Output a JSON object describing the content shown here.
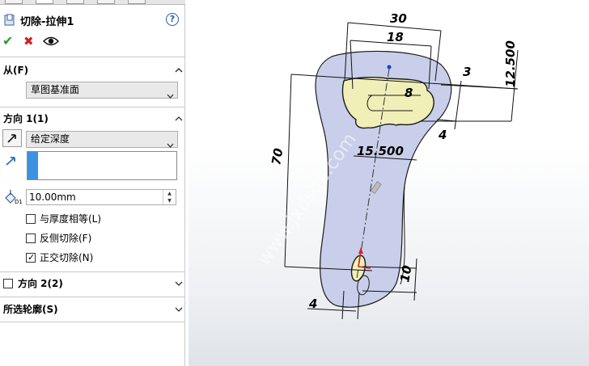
{
  "feature": {
    "title": "切除-拉伸1",
    "help": "?"
  },
  "actions": {
    "ok": "✔",
    "cancel": "✖"
  },
  "from": {
    "header": "从(F)",
    "value": "草图基准面"
  },
  "direction1": {
    "header": "方向 1(1)",
    "end_condition": "给定深度",
    "depth": "10.00mm",
    "options": [
      {
        "label": "与厚度相等(L)",
        "checked": false
      },
      {
        "label": "反侧切除(F)",
        "checked": false
      },
      {
        "label": "正交切除(N)",
        "checked": true
      }
    ]
  },
  "direction2": {
    "header": "方向 2(2)",
    "checked": false
  },
  "contours": {
    "header": "所选轮廓(S)"
  },
  "dimensions": {
    "d30": "30",
    "d18": "18",
    "d8": "8",
    "d3": "3",
    "d12_5": "12.500",
    "d4_right": "4",
    "d15_5": "15.500",
    "d70": "70",
    "d10": "10",
    "d4_bottom": "4"
  },
  "watermark": "www.jxdsge.com",
  "colors": {
    "part_fill": "#c9cfea",
    "selected_fill": "#f0efb8",
    "accent_blue": "#3b92e0"
  }
}
